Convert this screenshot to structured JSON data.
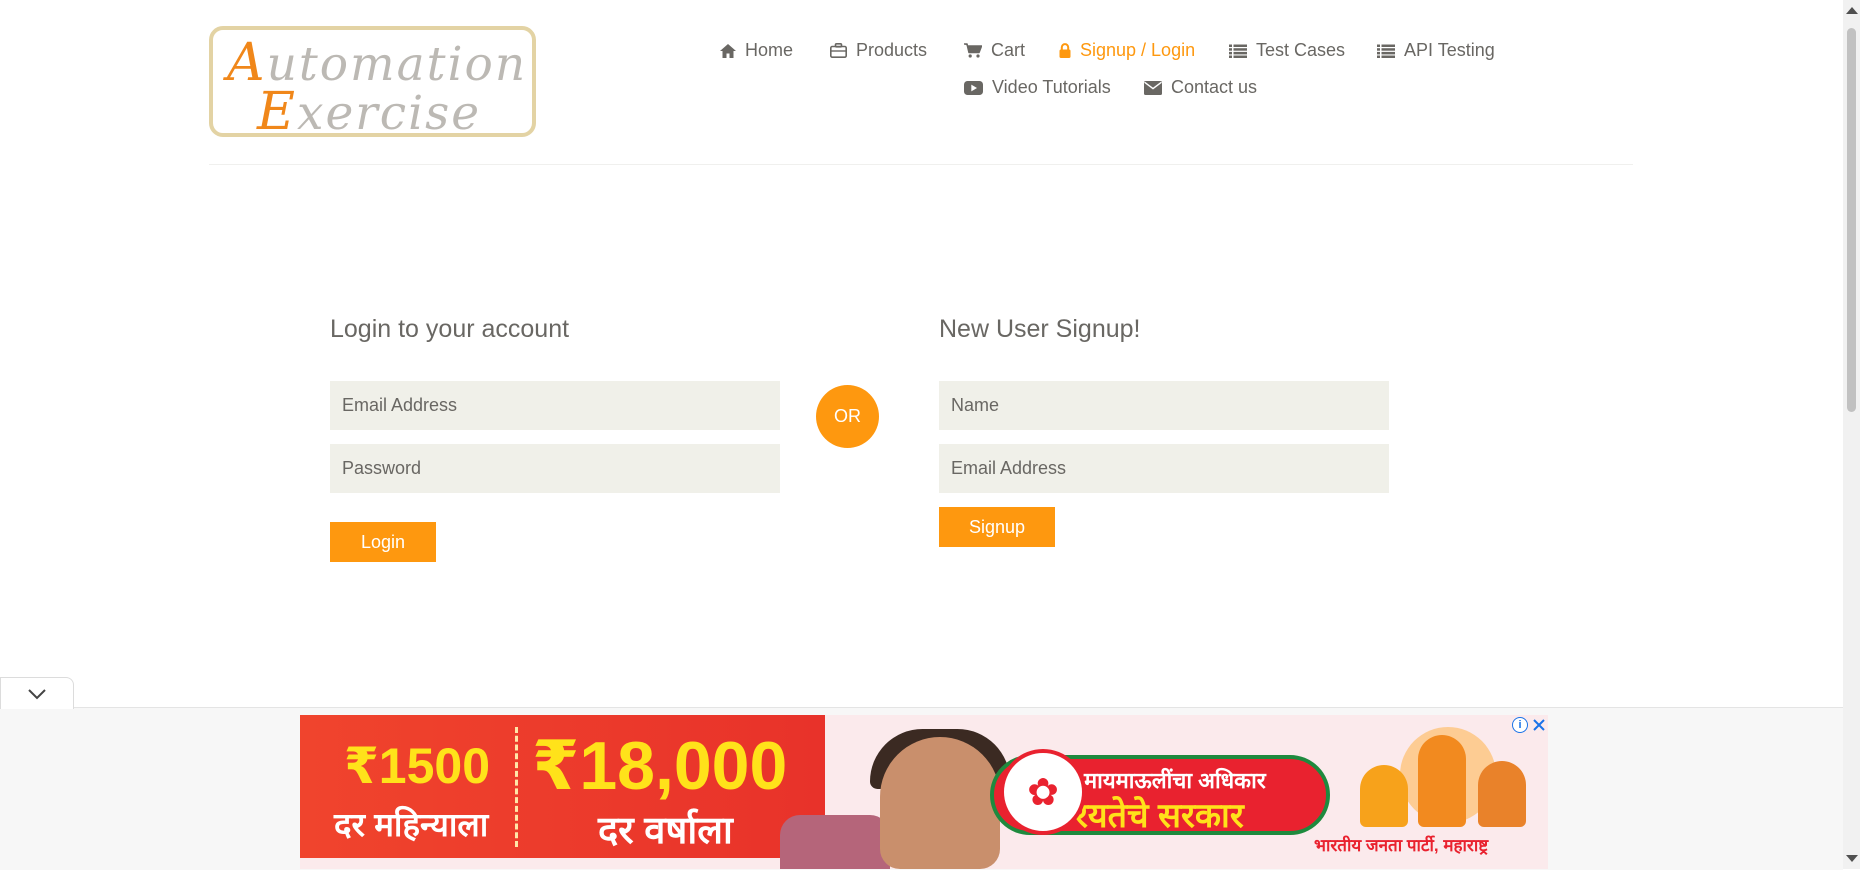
{
  "logo": {
    "line1_cap": "A",
    "line1_rest": "utomation",
    "line2_cap": "E",
    "line2_rest": "xercise"
  },
  "nav": {
    "home": "Home",
    "products": "Products",
    "cart": "Cart",
    "signup_login": "Signup / Login",
    "test_cases": "Test Cases",
    "api_testing": "API Testing",
    "video_tutorials": "Video Tutorials",
    "contact_us": "Contact us"
  },
  "login": {
    "title": "Login to your account",
    "email_placeholder": "Email Address",
    "password_placeholder": "Password",
    "button": "Login"
  },
  "or_label": "OR",
  "signup": {
    "title": "New User Signup!",
    "name_placeholder": "Name",
    "email_placeholder": "Email Address",
    "button": "Signup"
  },
  "ad": {
    "amount_month": "₹1500",
    "per_month": "दर महिन्याला",
    "amount_year": "₹18,000",
    "per_year": "दर वर्षाला",
    "slogan_line1": "मायमाऊलींचा अधिकार",
    "slogan_line2": "रयतेचे सरकार",
    "party": "भारतीय जनता पार्टी, महाराष्ट्र"
  },
  "colors": {
    "accent": "#fe980f",
    "text": "#696763",
    "field_bg": "#f0f0e9"
  },
  "icons": {
    "home": "home-icon",
    "products": "briefcase-icon",
    "cart": "cart-icon",
    "signup_login": "lock-icon",
    "test_cases": "list-icon",
    "api_testing": "list-icon",
    "video_tutorials": "youtube-play-icon",
    "contact_us": "envelope-icon",
    "ad_collapse": "chevron-down-icon",
    "ad_info": "info-icon",
    "ad_close": "close-icon"
  }
}
